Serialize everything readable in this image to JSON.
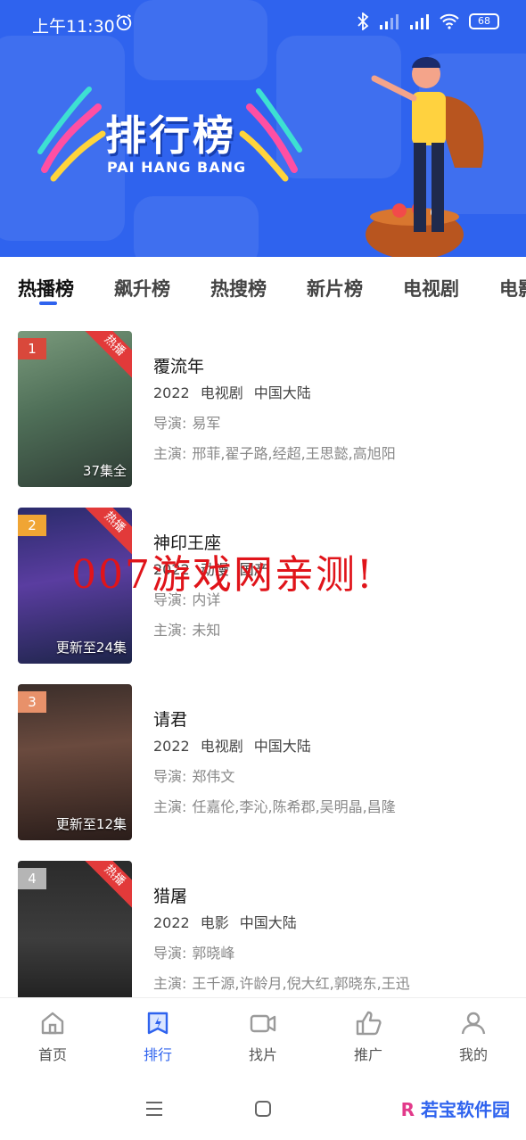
{
  "status_bar": {
    "time": "上午11:30",
    "battery": "68"
  },
  "banner": {
    "title": "排行榜",
    "subtitle": "PAI HANG BANG"
  },
  "tabs": [
    {
      "label": "热播榜",
      "active": true
    },
    {
      "label": "飙升榜",
      "active": false
    },
    {
      "label": "热搜榜",
      "active": false
    },
    {
      "label": "新片榜",
      "active": false
    },
    {
      "label": "电视剧",
      "active": false
    },
    {
      "label": "电影",
      "active": false
    }
  ],
  "items": [
    {
      "rank": "1",
      "rank_color": "#d9483b",
      "badge": "热播",
      "episodes": "37集全",
      "title": "覆流年",
      "year": "2022",
      "type": "电视剧",
      "region": "中国大陆",
      "director_label": "导演:",
      "director": "易军",
      "cast_label": "主演:",
      "cast": "邢菲,翟子路,经超,王思懿,高旭阳"
    },
    {
      "rank": "2",
      "rank_color": "#f0a534",
      "badge": "热播",
      "episodes": "更新至24集",
      "title": "神印王座",
      "year": "2022",
      "type": "动漫",
      "region": "国产",
      "director_label": "导演:",
      "director": "内详",
      "cast_label": "主演:",
      "cast": "未知"
    },
    {
      "rank": "3",
      "rank_color": "#e8916a",
      "badge": "",
      "episodes": "更新至12集",
      "title": "请君",
      "year": "2022",
      "type": "电视剧",
      "region": "中国大陆",
      "director_label": "导演:",
      "director": "郑伟文",
      "cast_label": "主演:",
      "cast": "任嘉伦,李沁,陈希郡,吴明晶,昌隆"
    },
    {
      "rank": "4",
      "rank_color": "#b5b5b5",
      "badge": "热播",
      "episodes": "",
      "title": "猎屠",
      "year": "2022",
      "type": "电影",
      "region": "中国大陆",
      "director_label": "导演:",
      "director": "郭晓峰",
      "cast_label": "主演:",
      "cast": "王千源,许龄月,倪大红,郭晓东,王迅"
    }
  ],
  "watermark": "007游戏网亲测!",
  "bottom_nav": [
    {
      "label": "首页",
      "icon": "home-icon",
      "active": false
    },
    {
      "label": "排行",
      "icon": "ranking-icon",
      "active": true
    },
    {
      "label": "找片",
      "icon": "video-icon",
      "active": false
    },
    {
      "label": "推广",
      "icon": "promote-icon",
      "active": false
    },
    {
      "label": "我的",
      "icon": "profile-icon",
      "active": false
    }
  ],
  "brand_watermark": {
    "letter": "R",
    "text": "若宝软件园"
  },
  "colors": {
    "accent": "#2f63ee",
    "hot_badge": "#e23a3a"
  }
}
